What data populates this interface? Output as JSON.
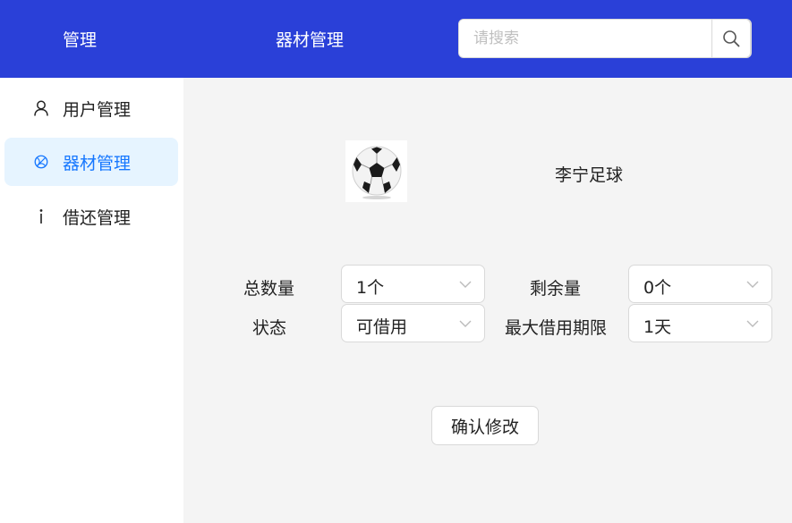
{
  "header": {
    "brand": "管理",
    "page_title": "器材管理",
    "search": {
      "placeholder": "请搜索",
      "value": ""
    }
  },
  "colors": {
    "header_bg": "#2a40d8",
    "active_bg": "#e6f4ff",
    "active_text": "#1677ff"
  },
  "sidebar": {
    "items": [
      {
        "label": "用户管理",
        "icon": "user-icon",
        "active": false
      },
      {
        "label": "器材管理",
        "icon": "basketball-icon",
        "active": true
      },
      {
        "label": "借还管理",
        "icon": "info-icon",
        "active": false
      }
    ]
  },
  "equipment": {
    "image_icon": "soccer-ball-icon",
    "name": "李宁足球",
    "fields": {
      "total": {
        "label": "总数量",
        "value": "1个"
      },
      "remaining": {
        "label": "剩余量",
        "value": "0个"
      },
      "status": {
        "label": "状态",
        "value": "可借用"
      },
      "max_period": {
        "label": "最大借用期限",
        "value": "1天"
      }
    },
    "confirm_label": "确认修改"
  }
}
